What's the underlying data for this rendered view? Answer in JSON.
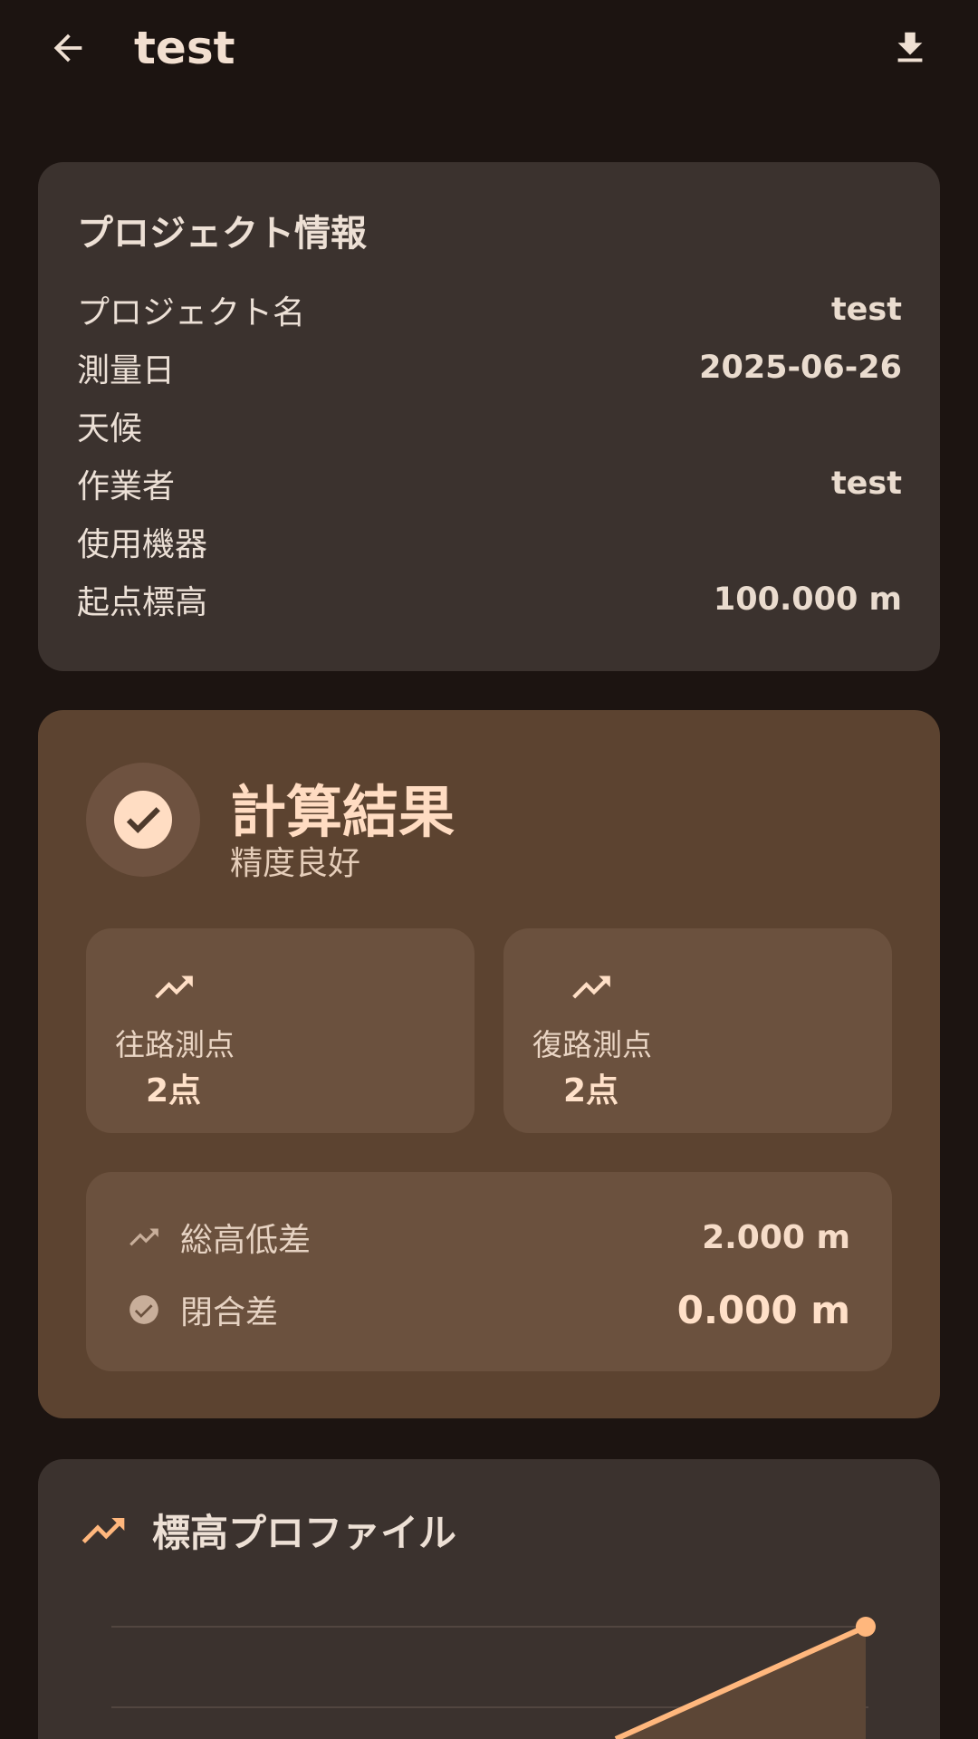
{
  "appbar": {
    "title": "test",
    "back_icon": "arrow-back-icon",
    "download_icon": "download-icon"
  },
  "project_info": {
    "title": "プロジェクト情報",
    "rows": [
      {
        "label": "プロジェクト名",
        "value": "test"
      },
      {
        "label": "測量日",
        "value": "2025-06-26"
      },
      {
        "label": "天候",
        "value": ""
      },
      {
        "label": "作業者",
        "value": "test"
      },
      {
        "label": "使用機器",
        "value": ""
      },
      {
        "label": "起点標高",
        "value": "100.000 m"
      }
    ]
  },
  "result": {
    "title": "計算結果",
    "status": "精度良好",
    "status_icon": "check-circle-icon",
    "forward": {
      "label": "往路測点",
      "value": "2点",
      "icon": "trending-up-icon"
    },
    "backward": {
      "label": "復路測点",
      "value": "2点",
      "icon": "trending-up-icon"
    },
    "total_diff": {
      "label": "総高低差",
      "value": "2.000 m",
      "icon": "trending-up-icon"
    },
    "closure": {
      "label": "閉合差",
      "value": "0.000 m",
      "icon": "check-circle-icon"
    }
  },
  "profile": {
    "title": "標高プロファイル",
    "icon": "trending-up-icon"
  },
  "colors": {
    "background": "#1c1411",
    "card": "#3b322e",
    "result_card": "#5c4330",
    "stat_box": "#6b513e",
    "accent": "#ffb77d"
  }
}
